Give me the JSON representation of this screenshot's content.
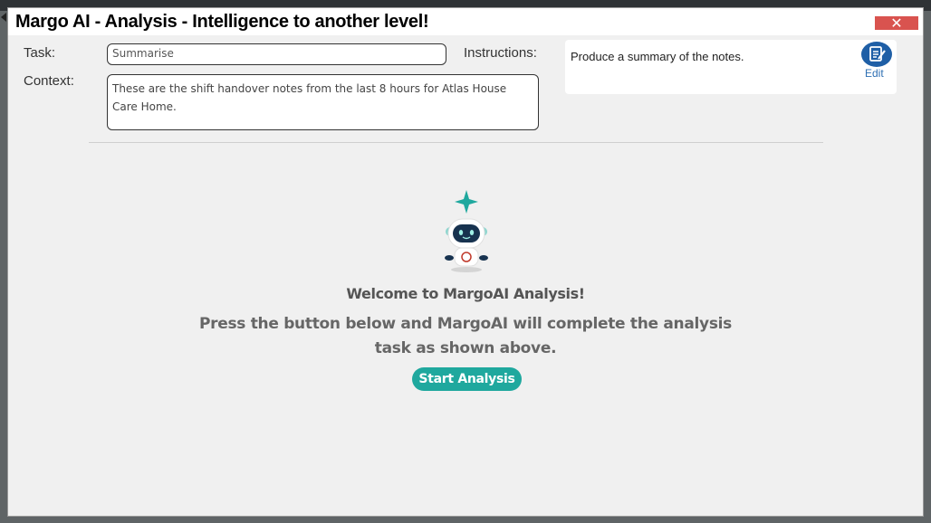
{
  "window": {
    "title": "Margo AI - Analysis - Intelligence to another level!",
    "close_icon": "close-x-icon"
  },
  "form": {
    "task_label": "Task:",
    "task_value": "Summarise",
    "context_label": "Context:",
    "context_value": "These are the shift handover notes from the last 8 hours for Atlas House Care Home.",
    "instructions_label": "Instructions:",
    "instructions_value": "Produce a summary of the notes.",
    "edit_label": "Edit",
    "edit_icon": "edit-document-icon"
  },
  "main": {
    "robot_icon": "robot-mascot-icon",
    "welcome_title": "Welcome to MargoAI Analysis!",
    "description": "Press the button below and MargoAI will complete the analysis task as shown above.",
    "start_button": "Start Analysis"
  },
  "colors": {
    "accent_teal": "#1fa89e",
    "close_red": "#d9534f",
    "edit_blue": "#1f5fa6"
  }
}
